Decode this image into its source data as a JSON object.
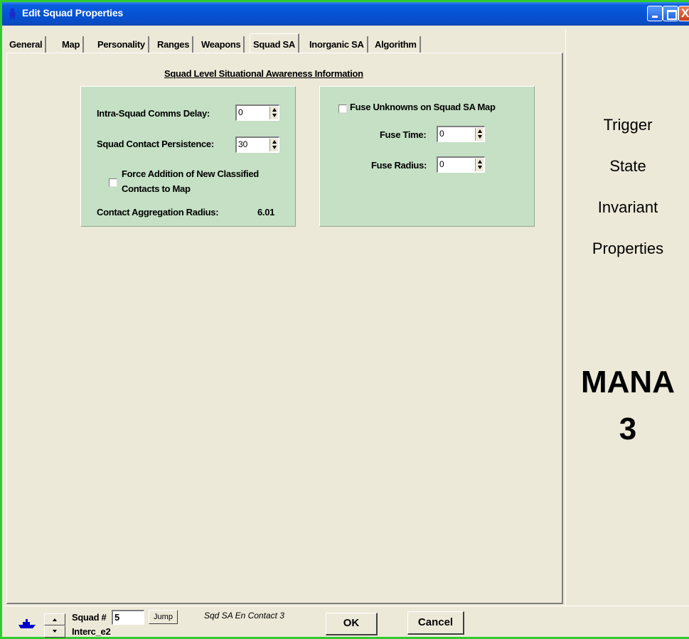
{
  "window": {
    "title": "Edit Squad Properties",
    "close_glyph": "X"
  },
  "tabs": [
    {
      "label": "General",
      "active": false
    },
    {
      "label": "Map",
      "active": false
    },
    {
      "label": "Personality",
      "active": false
    },
    {
      "label": "Ranges",
      "active": false
    },
    {
      "label": "Weapons",
      "active": false
    },
    {
      "label": "Squad SA",
      "active": true
    },
    {
      "label": "Inorganic SA",
      "active": false
    },
    {
      "label": "Algorithm",
      "active": false
    }
  ],
  "section_title": "Squad Level Situational Awareness Information",
  "left_panel": {
    "comms_delay_label": "Intra-Squad Comms Delay:",
    "comms_delay_value": "0",
    "contact_persistence_label": "Squad Contact Persistence:",
    "contact_persistence_value": "30",
    "force_addition_line1": "Force Addition of New Classified",
    "force_addition_line2": "Contacts to Map",
    "force_addition_checked": false,
    "aggregation_label": "Contact Aggregation Radius:",
    "aggregation_value": "6.01"
  },
  "right_panel": {
    "fuse_unknowns_label": "Fuse Unknowns on Squad SA Map",
    "fuse_unknowns_checked": false,
    "fuse_time_label": "Fuse Time:",
    "fuse_time_value": "0",
    "fuse_radius_label": "Fuse Radius:",
    "fuse_radius_value": "0"
  },
  "side": {
    "words": [
      "Trigger",
      "State",
      "Invariant",
      "Properties"
    ],
    "brand_line1": "MANA",
    "brand_line2": "3"
  },
  "bottom": {
    "squad_label": "Squad #",
    "squad_value": "5",
    "jump_label": "Jump",
    "squad_name": "Interc_e2",
    "status_text": "Sqd SA En Contact 3",
    "ok_label": "OK",
    "cancel_label": "Cancel",
    "squad_icon": "ship-icon"
  },
  "colors": {
    "titlebar": "#0552D4",
    "panel": "#C5E0C5",
    "window_border": "#2ECC2E",
    "icon_blue": "#0000CC"
  }
}
